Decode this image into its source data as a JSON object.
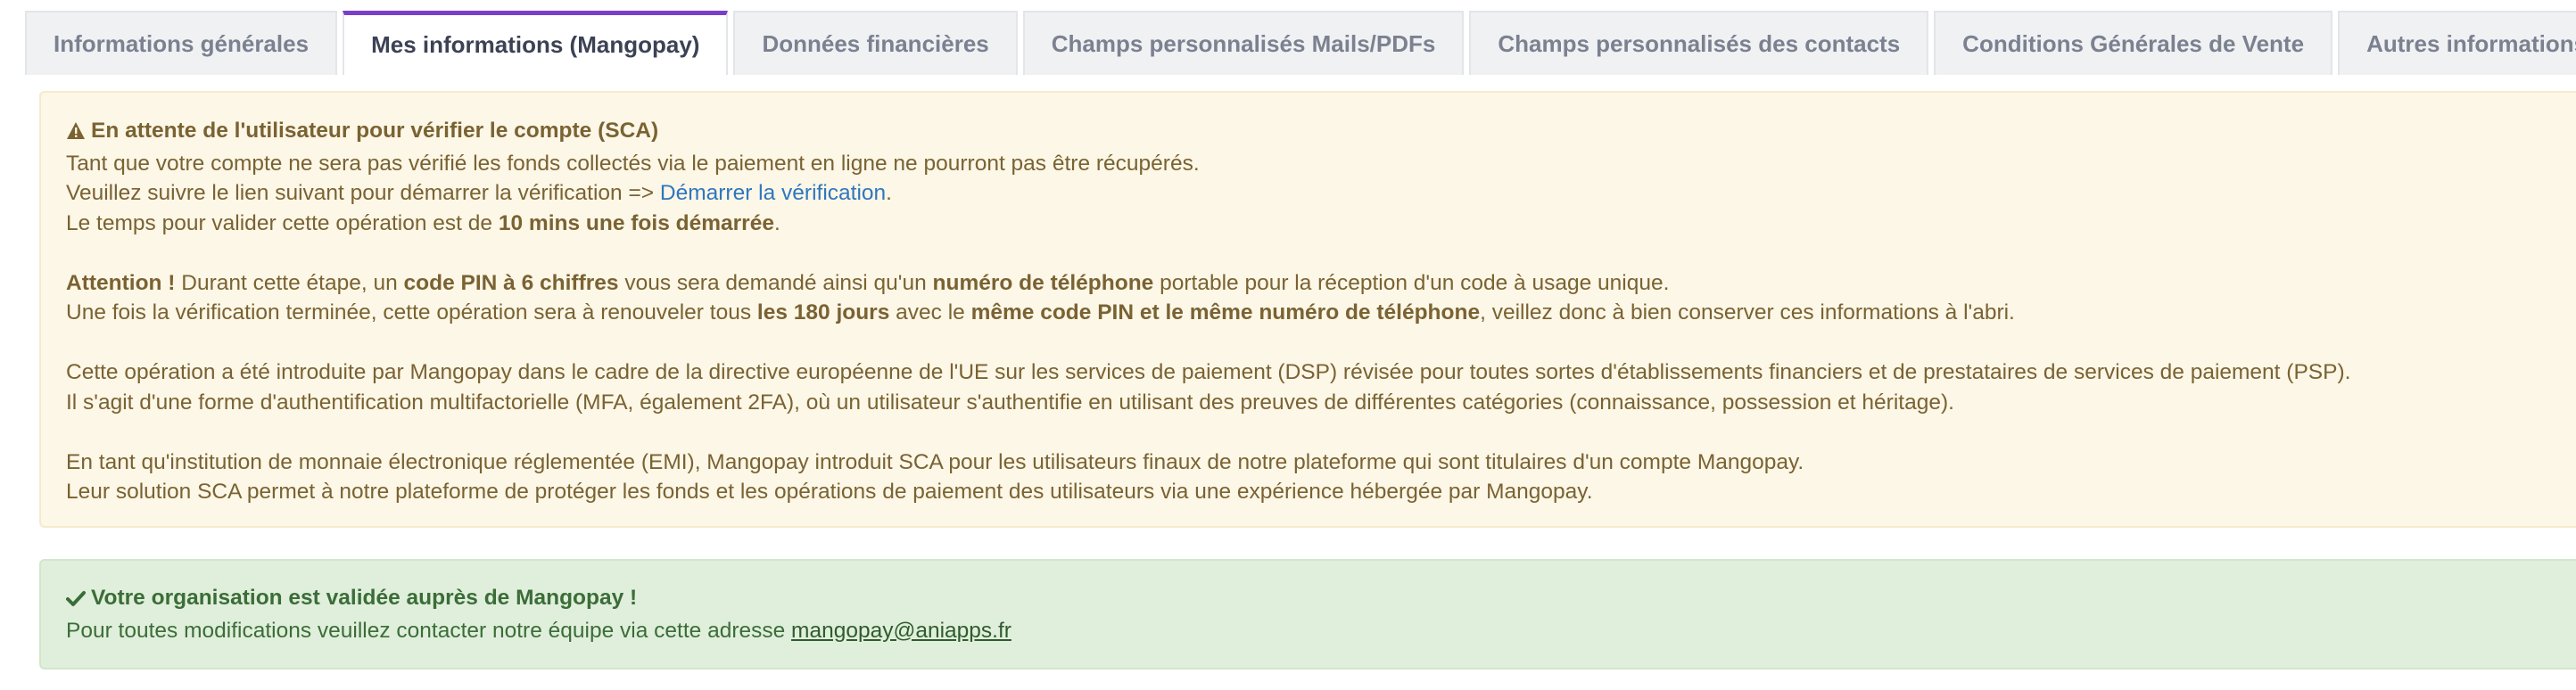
{
  "tabs": [
    {
      "label": "Informations générales",
      "active": false
    },
    {
      "label": "Mes informations (Mangopay)",
      "active": true
    },
    {
      "label": "Données financières",
      "active": false
    },
    {
      "label": "Champs personnalisés Mails/PDFs",
      "active": false
    },
    {
      "label": "Champs personnalisés des contacts",
      "active": false
    },
    {
      "label": "Conditions Générales de Vente",
      "active": false
    },
    {
      "label": "Autres informations",
      "active": false
    }
  ],
  "colors": {
    "active_tab_accent": "#7a3fc9",
    "warning_bg": "#fcf7e6",
    "warning_text": "#7a6233",
    "success_bg": "#e0efdb",
    "success_text": "#3b6d38",
    "link": "#2f76c0"
  },
  "warning": {
    "icon": "warning-triangle-icon",
    "title": "En attente de l'utilisateur pour vérifier le compte (SCA)",
    "line1": "Tant que votre compte ne sera pas vérifié les fonds collectés via le paiement en ligne ne pourront pas être récupérés.",
    "line2_prefix": "Veuillez suivre le lien suivant pour démarrer la vérification => ",
    "line2_link": "Démarrer la vérification",
    "line2_suffix": ".",
    "line3_prefix": "Le temps pour valider cette opération est de ",
    "line3_bold": "10 mins une fois démarrée",
    "line3_suffix": ".",
    "attention": {
      "b1": "Attention !",
      "t1": " Durant cette étape, un ",
      "b2": "code PIN à 6 chiffres",
      "t2": " vous sera demandé ainsi qu'un ",
      "b3": "numéro de téléphone",
      "t3": " portable pour la réception d'un code à usage unique."
    },
    "renew": {
      "t1": "Une fois la vérification terminée, cette opération sera à renouveler tous ",
      "b1": "les 180 jours",
      "t2": " avec le ",
      "b2": "même code PIN et le même numéro de téléphone",
      "t3": ", veillez donc à bien conserver ces informations à l'abri."
    },
    "para2_line1": "Cette opération a été introduite par Mangopay dans le cadre de la directive européenne de l'UE sur les services de paiement (DSP) révisée pour toutes sortes d'établissements financiers et de prestataires de services de paiement (PSP).",
    "para2_line2": "Il s'agit d'une forme d'authentification multifactorielle (MFA, également 2FA), où un utilisateur s'authentifie en utilisant des preuves de différentes catégories (connaissance, possession et héritage).",
    "para3_line1": "En tant qu'institution de monnaie électronique réglementée (EMI), Mangopay introduit SCA pour les utilisateurs finaux de notre plateforme qui sont titulaires d'un compte Mangopay.",
    "para3_line2": "Leur solution SCA permet à notre plateforme de protéger les fonds et les opérations de paiement des utilisateurs via une expérience hébergée par Mangopay."
  },
  "success": {
    "icon": "checkmark-icon",
    "title": "Votre organisation est validée auprès de Mangopay !",
    "line_prefix": "Pour toutes modifications veuillez contacter notre équipe via cette adresse ",
    "email": "mangopay@aniapps.fr"
  }
}
